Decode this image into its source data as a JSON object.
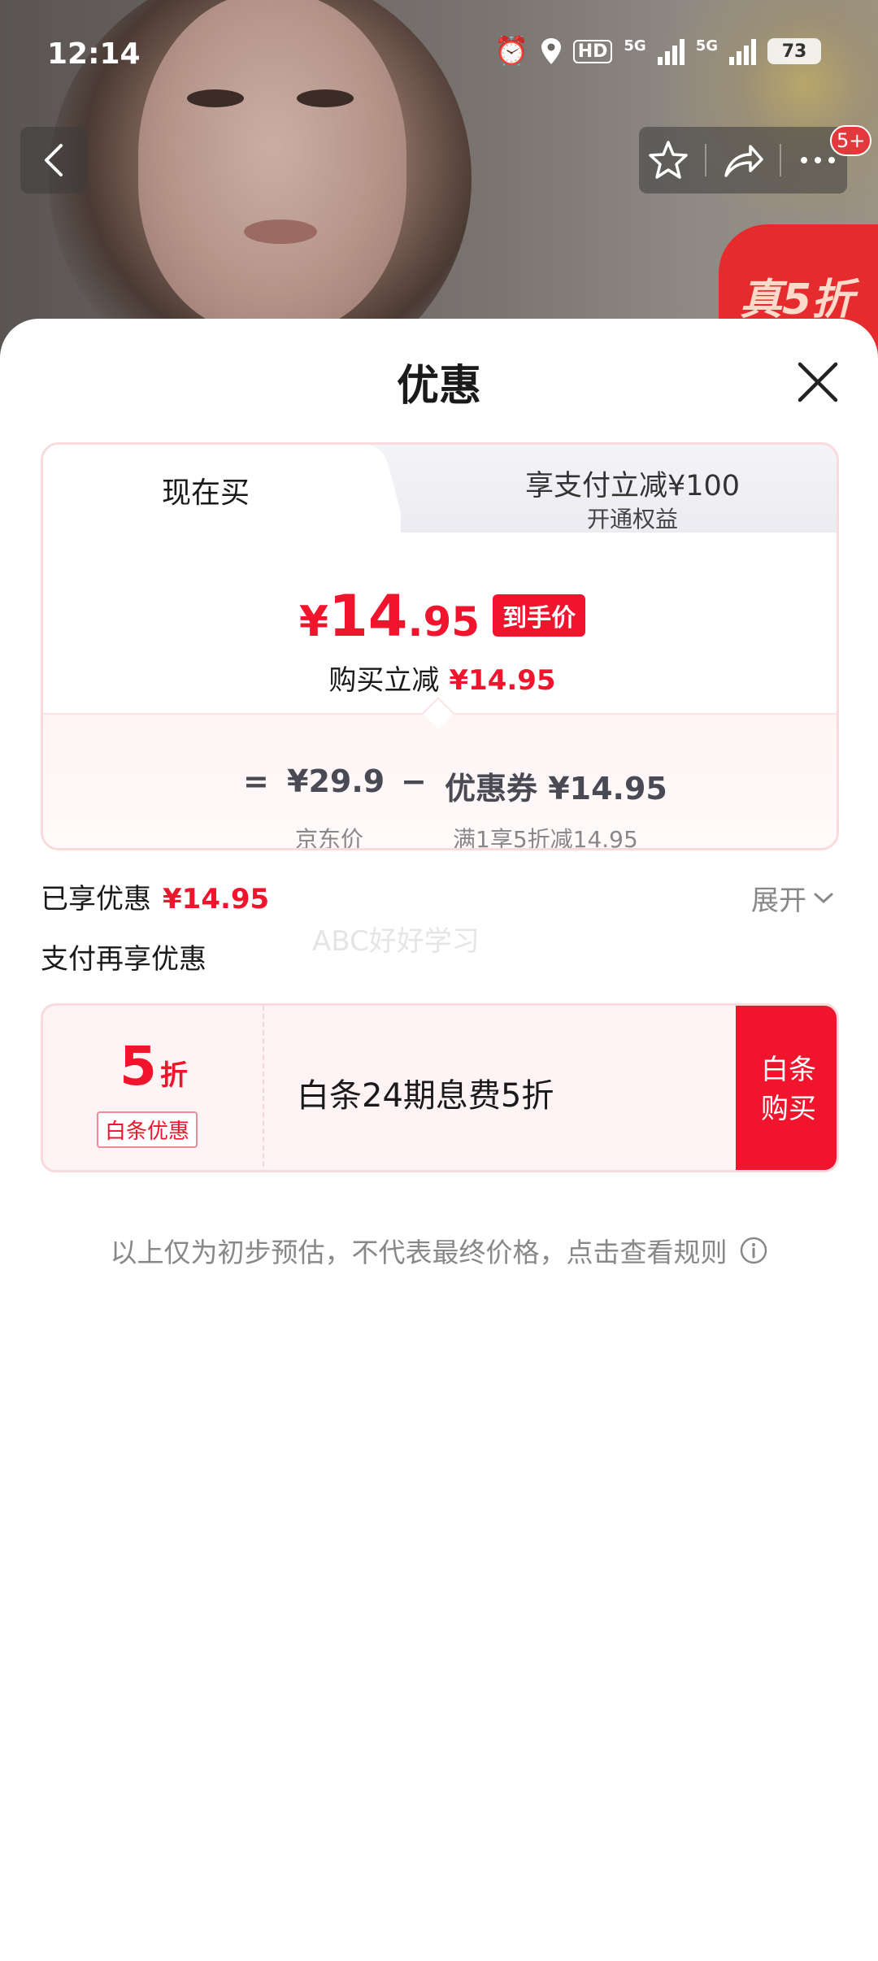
{
  "status_bar": {
    "time": "12:14",
    "hd_label": "HD",
    "net_label_1": "5G",
    "net_label_2": "5G",
    "battery": "73"
  },
  "background": {
    "promo_tag": "真5折",
    "message_badge": "5+"
  },
  "modal": {
    "title": "优惠",
    "tabs": {
      "now": "现在买",
      "pay_title": "享支付立减¥100",
      "pay_sub": "开通权益"
    },
    "final_price": {
      "currency": "¥",
      "integer": "14",
      "decimal": ".95",
      "badge": "到手价"
    },
    "instant_discount": {
      "label": "购买立减",
      "amount": "¥14.95"
    },
    "formula": {
      "equals": "=",
      "jd_price": "¥29.9",
      "minus": "−",
      "coupon": "优惠券 ¥14.95",
      "jd_price_label": "京东价",
      "coupon_label": "满1享5折减14.95"
    },
    "saved": {
      "label": "已享优惠",
      "amount": "¥14.95",
      "expand": "展开"
    },
    "watermark": "ABC好好学习",
    "pay_more": "支付再享优惠",
    "offer": {
      "discount_num": "5",
      "discount_unit": "折",
      "tag": "白条优惠",
      "text": "白条24期息费5折",
      "button_line1": "白条",
      "button_line2": "购买"
    },
    "disclaimer": "以上仅为初步预估，不代表最终价格，点击查看规则"
  },
  "colors": {
    "accent_red": "#f0142c",
    "card_border": "#fadadd",
    "muted_text": "#888888"
  }
}
